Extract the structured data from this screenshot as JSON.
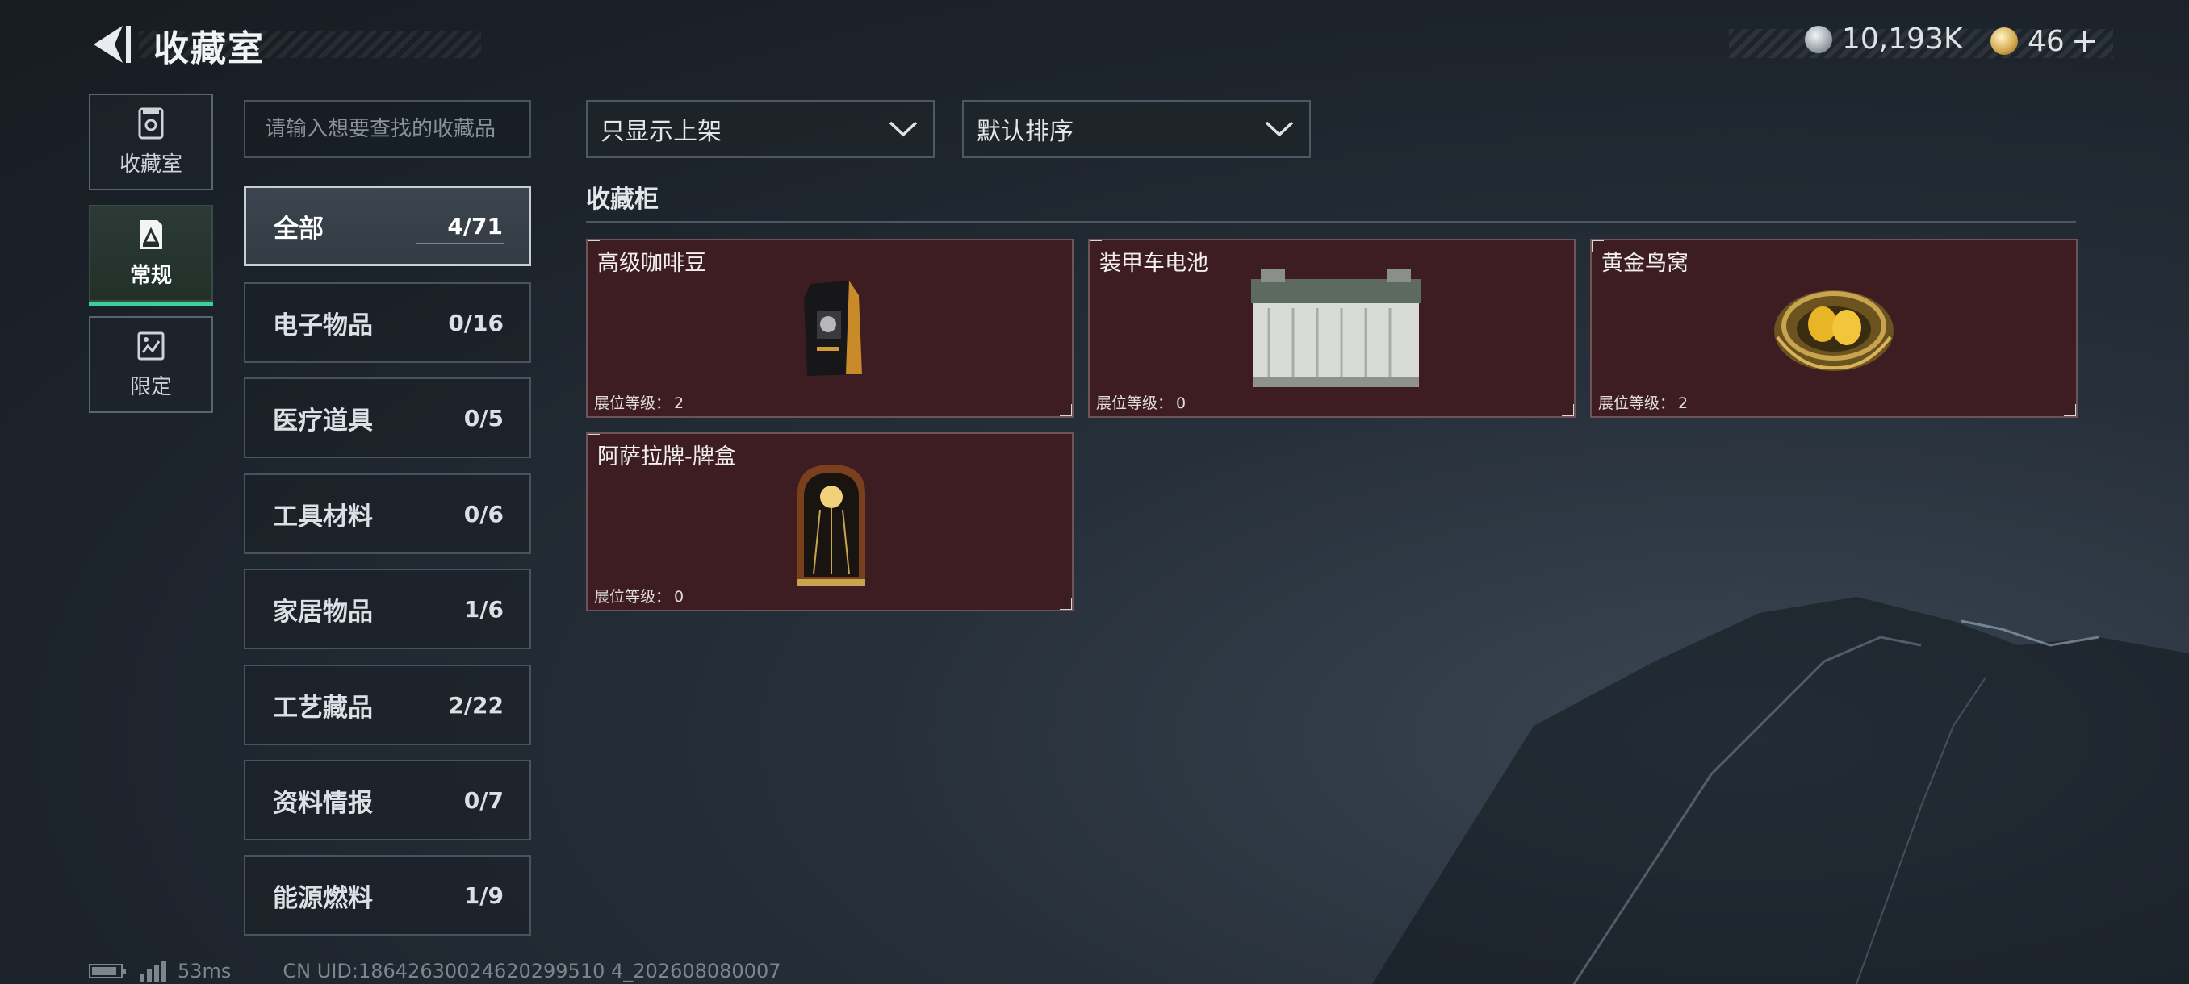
{
  "header": {
    "title": "收藏室",
    "currency_main": "10,193K",
    "currency_premium": "46",
    "currency_add": "+"
  },
  "side_tabs": [
    {
      "label": "收藏室",
      "icon": "collection-room-icon",
      "active": false
    },
    {
      "label": "常规",
      "icon": "regular-icon",
      "active": true
    },
    {
      "label": "限定",
      "icon": "limited-icon",
      "active": false
    }
  ],
  "search": {
    "placeholder": "请输入想要查找的收藏品"
  },
  "filters": {
    "display_filter": "只显示上架",
    "sort": "默认排序"
  },
  "categories": [
    {
      "name": "全部",
      "count": "4/71",
      "active": true
    },
    {
      "name": "电子物品",
      "count": "0/16"
    },
    {
      "name": "医疗道具",
      "count": "0/5"
    },
    {
      "name": "工具材料",
      "count": "0/6"
    },
    {
      "name": "家居物品",
      "count": "1/6"
    },
    {
      "name": "工艺藏品",
      "count": "2/22"
    },
    {
      "name": "资料情报",
      "count": "0/7"
    },
    {
      "name": "能源燃料",
      "count": "1/9"
    }
  ],
  "cabinet": {
    "title": "收藏柜",
    "level_label": "展位等级：",
    "items": [
      {
        "name": "高级咖啡豆",
        "level": "2",
        "icon": "coffee-bag-icon"
      },
      {
        "name": "装甲车电池",
        "level": "0",
        "icon": "car-battery-icon"
      },
      {
        "name": "黄金鸟窝",
        "level": "2",
        "icon": "golden-nest-icon"
      },
      {
        "name": "阿萨拉牌-牌盒",
        "level": "0",
        "icon": "card-box-icon"
      }
    ]
  },
  "footer": {
    "ping": "53ms",
    "uid": "CN UID:18642630024620299510 4_202608080007"
  },
  "colors": {
    "accent_green": "#36d39a",
    "item_bg": "#3d1d22"
  }
}
